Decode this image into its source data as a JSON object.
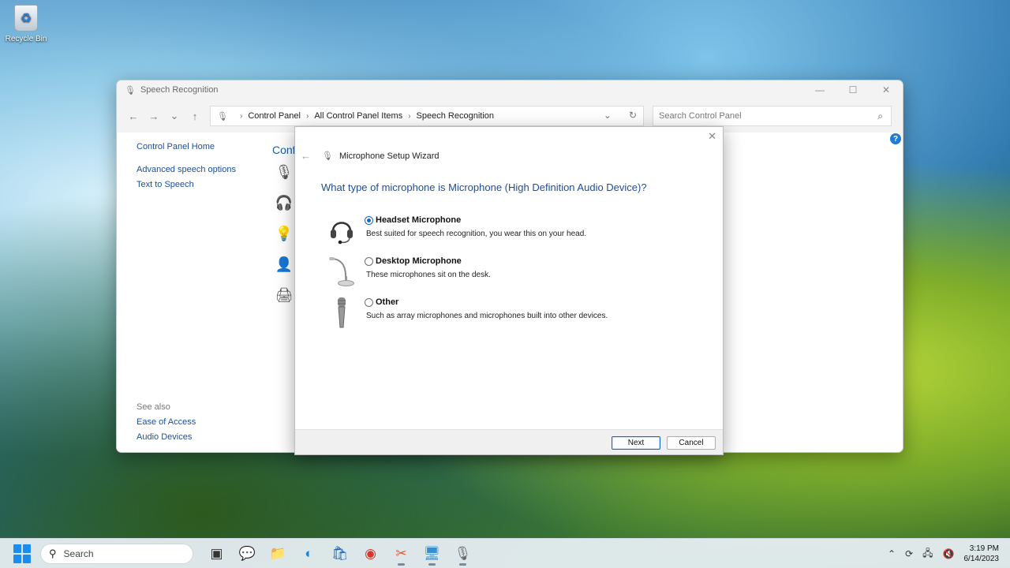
{
  "desktop": {
    "recycle_bin_label": "Recycle Bin"
  },
  "window": {
    "title": "Speech Recognition",
    "breadcrumb": [
      "Control Panel",
      "All Control Panel Items",
      "Speech Recognition"
    ],
    "search_placeholder": "Search Control Panel",
    "sidebar": {
      "home": "Control Panel Home",
      "links": [
        "Advanced speech options",
        "Text to Speech"
      ]
    },
    "see_also": {
      "label": "See also",
      "links": [
        "Ease of Access",
        "Audio Devices"
      ]
    },
    "partial_heading": "Conf"
  },
  "wizard": {
    "title": "Microphone Setup Wizard",
    "question": "What type of microphone is Microphone (High Definition Audio Device)?",
    "options": [
      {
        "label": "Headset Microphone",
        "description": "Best suited for speech recognition, you wear this on your head.",
        "selected": true,
        "icon": "headset-icon"
      },
      {
        "label": "Desktop Microphone",
        "description": "These microphones sit on the desk.",
        "selected": false,
        "icon": "desktop-microphone-icon"
      },
      {
        "label": "Other",
        "description": "Such as array microphones and microphones built into other devices.",
        "selected": false,
        "icon": "handheld-microphone-icon"
      }
    ],
    "next_label": "Next",
    "cancel_label": "Cancel"
  },
  "taskbar": {
    "search_label": "Search",
    "time": "3:19 PM",
    "date": "6/14/2023"
  }
}
